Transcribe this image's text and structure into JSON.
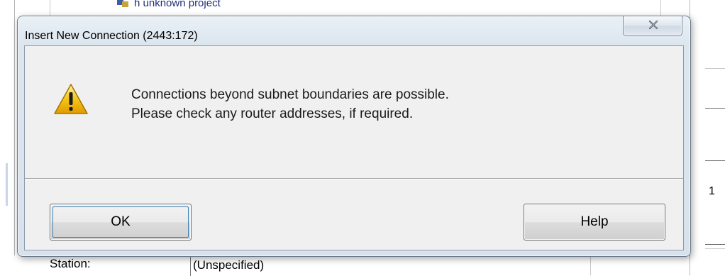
{
  "background": {
    "tree_item": "h unknown project",
    "station_label": "Station:",
    "station_value": "(Unspecified)",
    "right_digit": "1"
  },
  "dialog": {
    "title": "Insert New Connection (2443:172)",
    "close_icon": "close-icon",
    "warning_icon": "warning-icon",
    "message_lines": [
      "Connections beyond subnet boundaries are possible.",
      "Please check any router addresses, if required."
    ],
    "buttons": {
      "ok_label": "OK",
      "help_label": "Help"
    }
  },
  "colors": {
    "warning_yellow": "#f5c518",
    "focus_ring": "#3c7fb1",
    "frame": "#dce6ef"
  }
}
